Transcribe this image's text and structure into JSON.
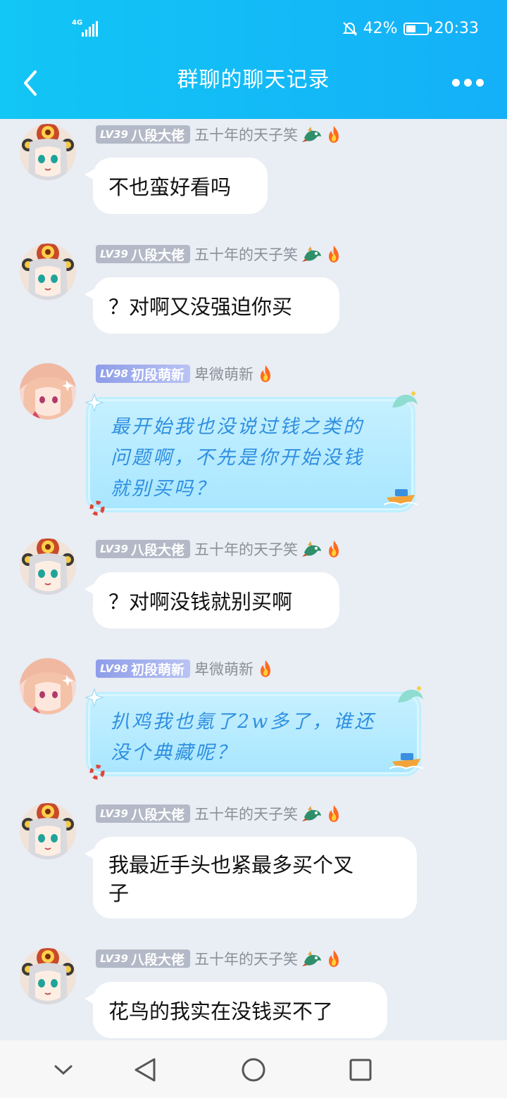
{
  "status_bar": {
    "network": "4G",
    "battery": "42%",
    "time": "20:33"
  },
  "header": {
    "title": "群聊的聊天记录"
  },
  "colors": {
    "header": "#14b0f8",
    "background": "#e9edf4",
    "fancy_text": "#2f8fe0"
  },
  "messages": [
    {
      "lv": "LV39",
      "rank": "八段大佬",
      "nick": "五十年的天子笑",
      "text": "不也蛮好看吗"
    },
    {
      "lv": "LV39",
      "rank": "八段大佬",
      "nick": "五十年的天子笑",
      "text": "？对啊又没强迫你买"
    },
    {
      "lv": "LV98",
      "rank": "初段萌新",
      "nick": "卑微萌新",
      "lines": [
        "最开始我也没说过钱之类的",
        "问题啊，不先是你开始没钱",
        "就别买吗？"
      ]
    },
    {
      "lv": "LV39",
      "rank": "八段大佬",
      "nick": "五十年的天子笑",
      "text": "？对啊没钱就别买啊"
    },
    {
      "lv": "LV98",
      "rank": "初段萌新",
      "nick": "卑微萌新",
      "lines": [
        "扒鸡我也氪了2w多了，谁还",
        "没个典藏呢？"
      ]
    },
    {
      "lv": "LV39",
      "rank": "八段大佬",
      "nick": "五十年的天子笑",
      "lines": [
        "我最近手头也紧最多买个叉",
        "子"
      ]
    },
    {
      "lv": "LV39",
      "rank": "八段大佬",
      "nick": "五十年的天子笑",
      "text": "花鸟的我实在没钱买不了"
    }
  ]
}
